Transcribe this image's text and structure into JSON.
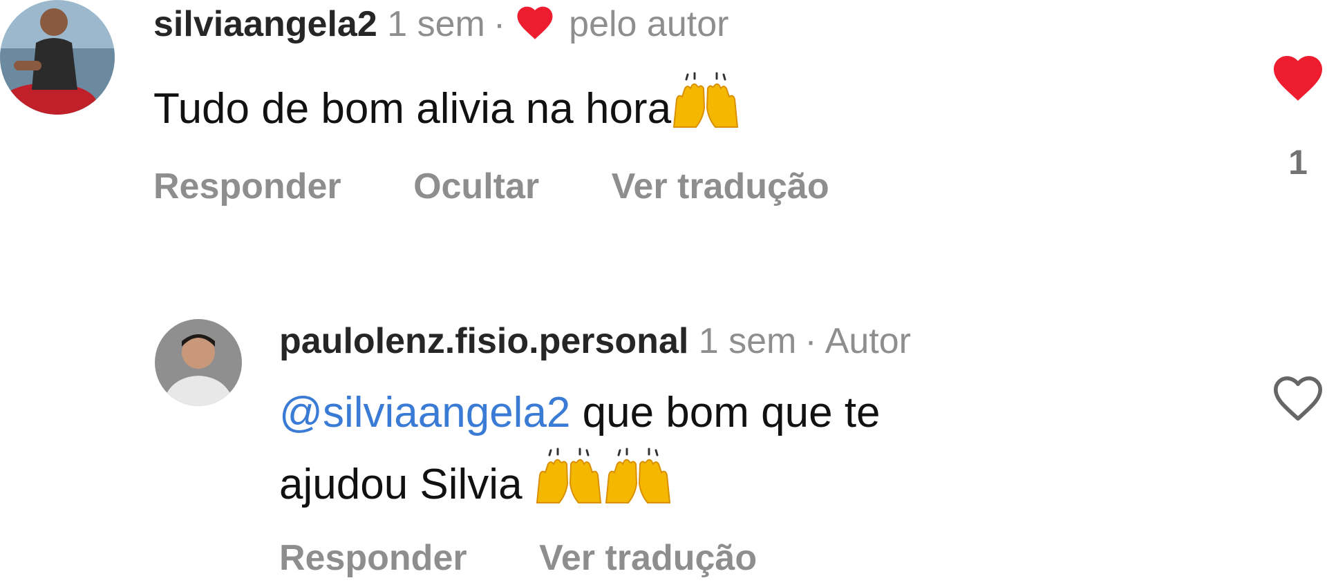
{
  "comments": [
    {
      "username": "silviaangela2",
      "time": "1 sem",
      "separator": "·",
      "liked_by_author": "pelo autor",
      "text": "Tudo de bom alivia na hora",
      "actions": [
        "Responder",
        "Ocultar",
        "Ver tradução"
      ],
      "likes": "1",
      "liked": true
    },
    {
      "username": "paulolenz.fisio.personal",
      "time": "1 sem",
      "separator": "·",
      "author_label": "Autor",
      "mention": "@silviaangela2",
      "text_line1": "que bom que te",
      "text_line2": "ajudou Silvia",
      "actions": [
        "Responder",
        "Ver tradução"
      ],
      "liked": false
    }
  ],
  "colors": {
    "like_red": "#ed1c2e",
    "mention_blue": "#3a7bd5",
    "muted_gray": "#8e8e8e"
  },
  "icons": {
    "like_filled": "heart-icon",
    "like_outline": "heart-outline-icon",
    "raising_hands": "raising-hands-emoji"
  }
}
